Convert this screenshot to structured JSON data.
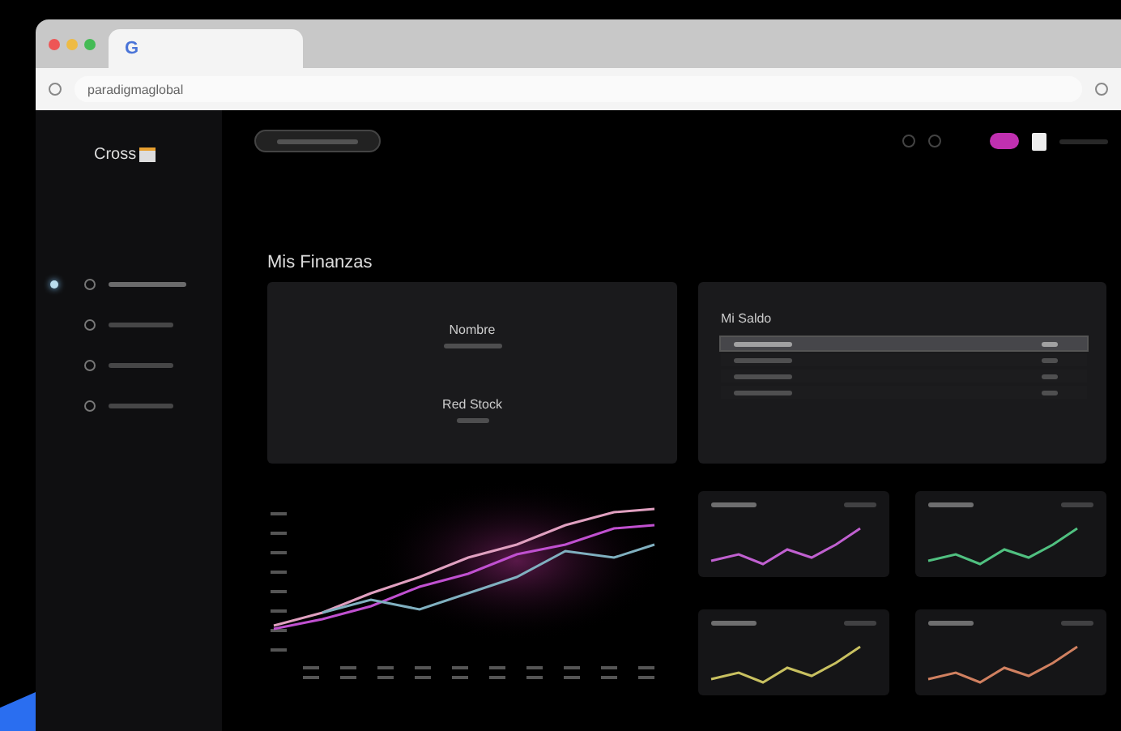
{
  "browser": {
    "tab_icon": "G",
    "url": "paradigmaglobal"
  },
  "app": {
    "logo": "Cross",
    "nav": [
      {
        "selected": true
      },
      {
        "selected": false
      },
      {
        "selected": false
      },
      {
        "selected": false
      }
    ],
    "page_title": "Mis Finanzas",
    "profile_card": {
      "name": "Nombre",
      "stock": "Red Stock"
    },
    "balance": {
      "title": "Mi Saldo",
      "rows": [
        {
          "selected": true
        },
        {
          "selected": false
        },
        {
          "selected": false
        },
        {
          "selected": false
        }
      ]
    },
    "mini_charts": [
      {
        "color": "#c060d0"
      },
      {
        "color": "#50c080"
      },
      {
        "color": "#c8c060"
      },
      {
        "color": "#d08060"
      }
    ]
  }
}
